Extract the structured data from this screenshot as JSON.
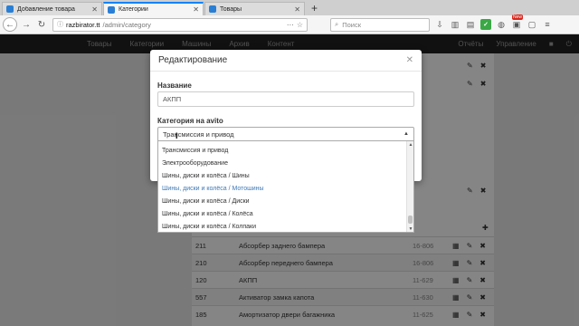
{
  "browser": {
    "tabs": [
      {
        "label": "Добавление товара",
        "active": false
      },
      {
        "label": "Категории",
        "active": true
      },
      {
        "label": "Товары",
        "active": false
      }
    ],
    "url_host": "razbirator.tt",
    "url_path": "/admin/category",
    "search_placeholder": "Поиск",
    "badge_new": "New"
  },
  "sitenav": {
    "items": [
      "Товары",
      "Категории",
      "Машины",
      "Архив",
      "Контент"
    ],
    "right_items": [
      "Отчёты",
      "Управление"
    ]
  },
  "modal": {
    "title": "Редактирование",
    "name_label": "Название",
    "name_value": "АКПП",
    "category_label": "Категория на avito",
    "category_value": "Трансмиссия и привод"
  },
  "dropdown": {
    "items": [
      "Трансмиссия и привод",
      "Электрооборудование",
      "Шины, диски и колёса / Шины",
      "Шины, диски и колёса / Мотошины",
      "Шины, диски и колёса / Диски",
      "Шины, диски и колёса / Колёса",
      "Шины, диски и колёса / Колпаки"
    ],
    "hovered_index": 3
  },
  "table": {
    "rows": [
      {
        "id": "211",
        "name": "Абсорбер заднего бампера",
        "code": "16-806"
      },
      {
        "id": "210",
        "name": "Абсорбер переднего бампера",
        "code": "16-806"
      },
      {
        "id": "120",
        "name": "АКПП",
        "code": "11-629"
      },
      {
        "id": "557",
        "name": "Активатор замка капота",
        "code": "11-630"
      },
      {
        "id": "185",
        "name": "Амортизатор двери багажника",
        "code": "11-625"
      }
    ]
  },
  "colors": {
    "accent": "#0a84ff",
    "nav_bg": "#222222",
    "link_hover": "#3f7ab8"
  }
}
